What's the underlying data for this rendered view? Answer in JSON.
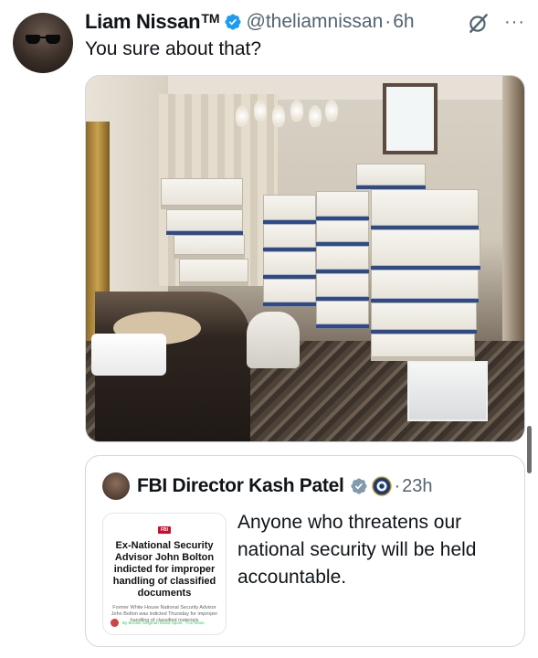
{
  "tweet": {
    "author_name": "Liam Nissan",
    "author_tm": "TM",
    "handle": "@theliamnissan",
    "separator": "·",
    "time": "6h",
    "text": "You sure about that?",
    "more_label": "···"
  },
  "quoted_tweet": {
    "author_name": "FBI Director Kash Patel",
    "separator": "·",
    "time": "23h",
    "text": "Anyone who threatens our national security will be held accountable.",
    "card": {
      "logo": "FBI",
      "headline": "Ex-National Security Advisor John Bolton indicted for improper handling of classified documents",
      "subtext": "Former White House National Security Advisor John Bolton was indicted Thursday for improper handling of classified materials",
      "byline": "By Brooke Singman  David Spunt",
      "source": "Fox News"
    }
  },
  "colors": {
    "verified_blue": "#1d9bf0",
    "secondary_text": "#536471",
    "border": "#cfd9de"
  }
}
